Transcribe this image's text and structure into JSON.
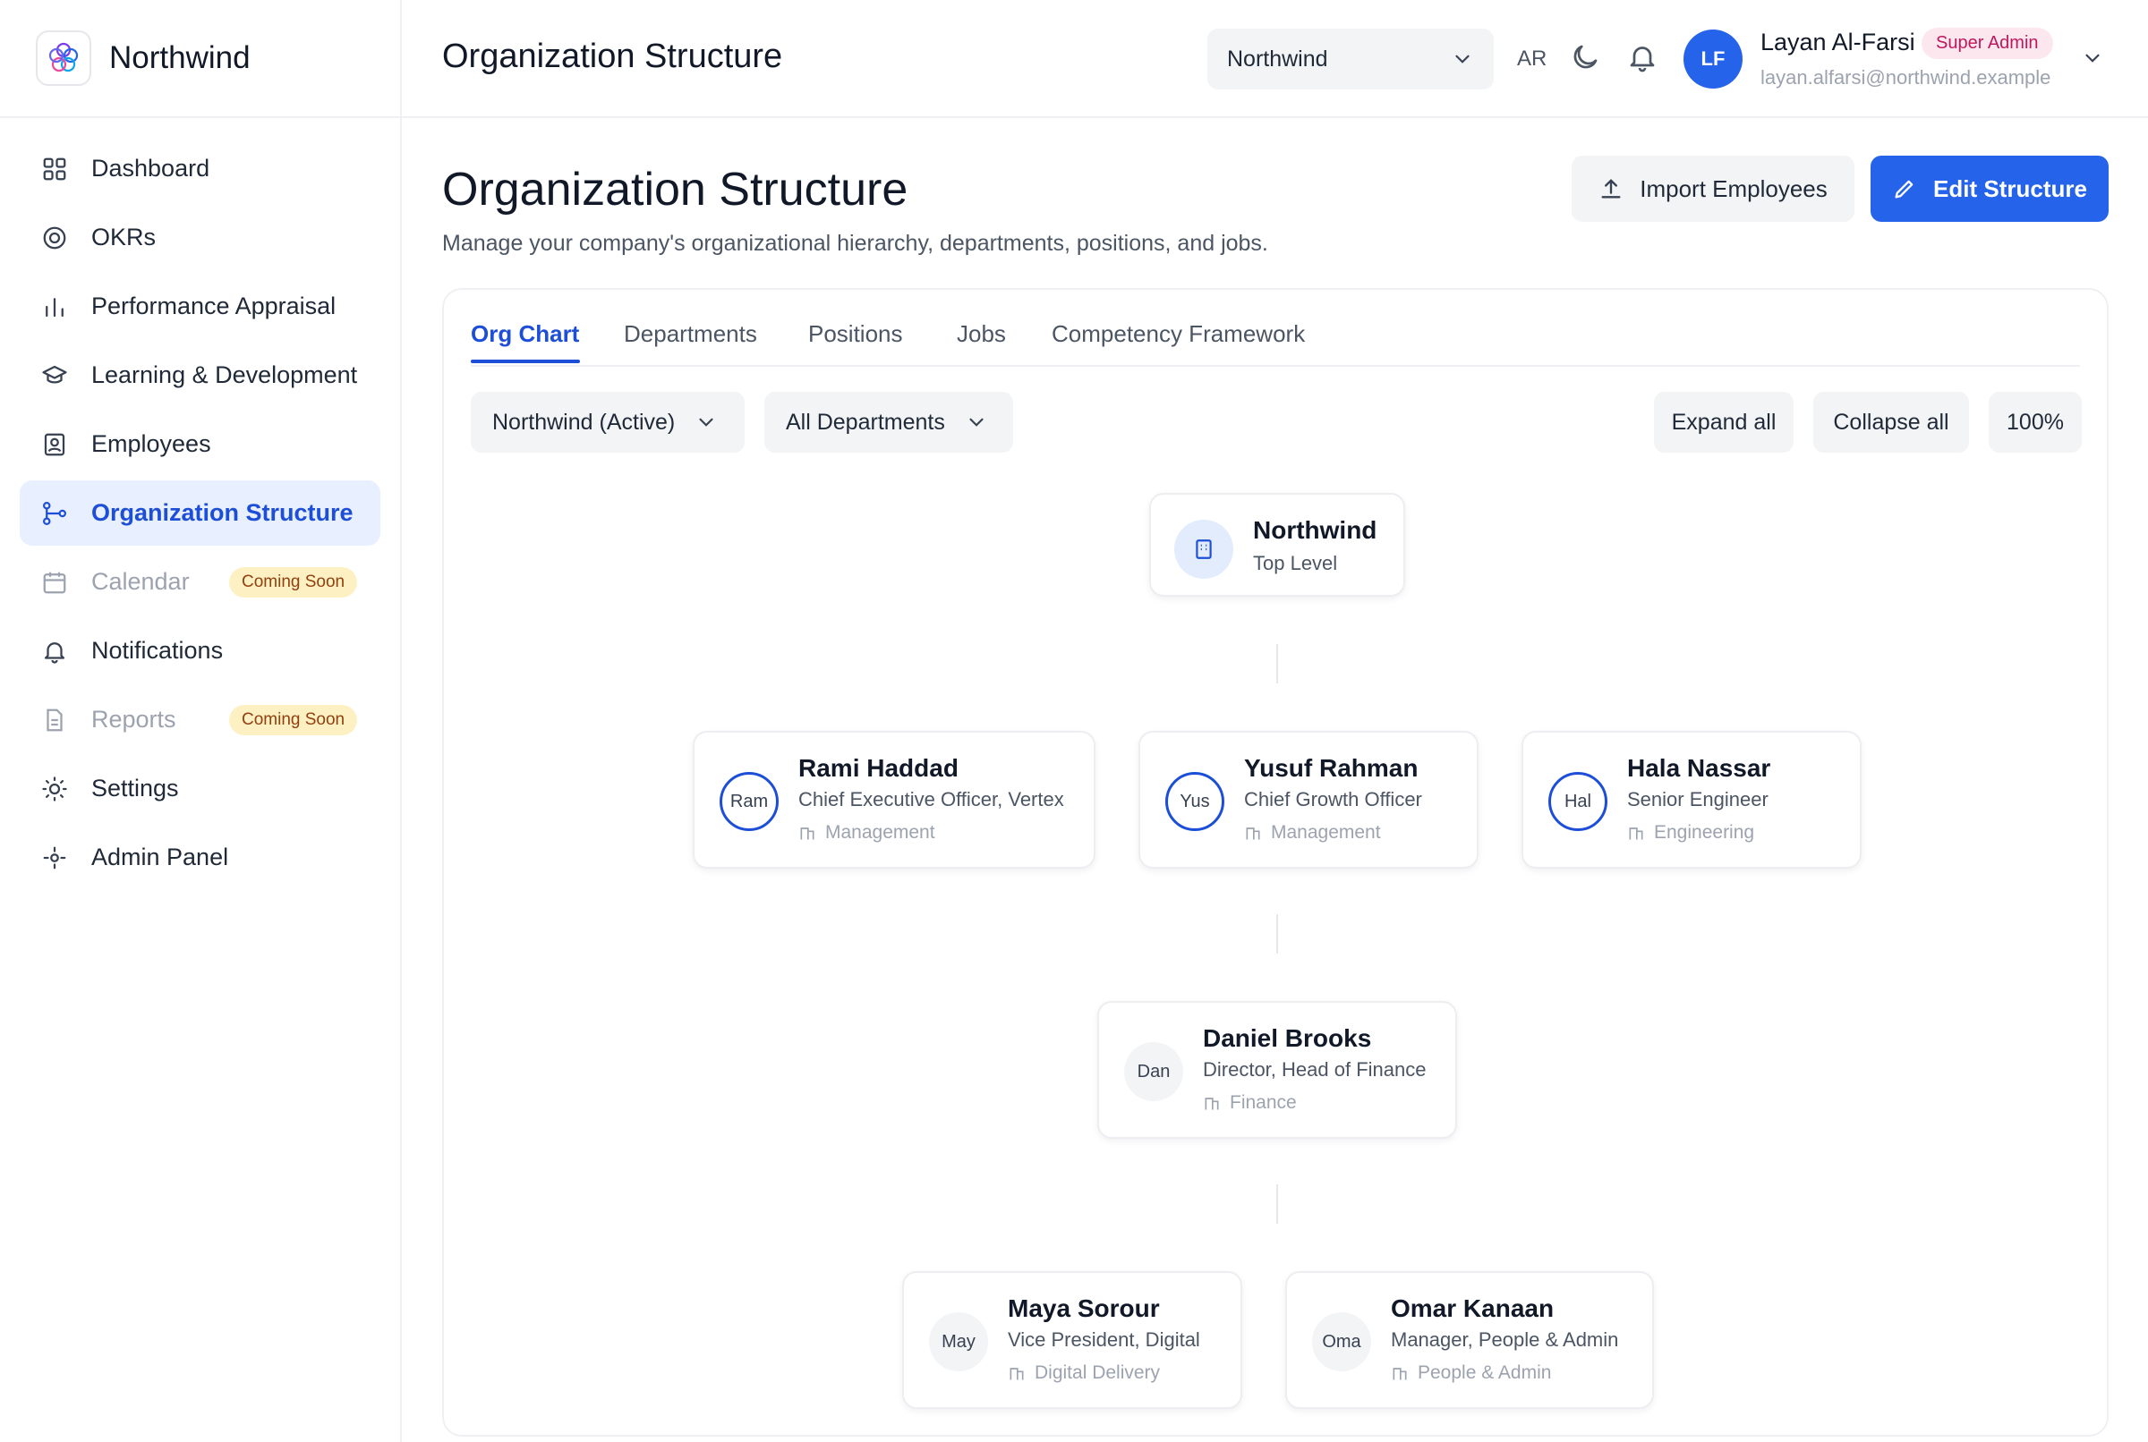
{
  "brand": {
    "name": "Northwind",
    "logo": "flower-logo-icon"
  },
  "sidebar": {
    "items": [
      {
        "label": "Dashboard",
        "icon": "grid-icon"
      },
      {
        "label": "OKRs",
        "icon": "target-icon"
      },
      {
        "label": "Performance Appraisal",
        "icon": "bar-chart-icon"
      },
      {
        "label": "Learning & Development",
        "icon": "graduation-cap-icon"
      },
      {
        "label": "Employees",
        "icon": "id-badge-icon"
      },
      {
        "label": "Organization Structure",
        "icon": "hierarchy-icon",
        "active": true
      },
      {
        "label": "Calendar",
        "icon": "calendar-icon",
        "badge": "Coming Soon",
        "disabled": true
      },
      {
        "label": "Notifications",
        "icon": "bell-icon"
      },
      {
        "label": "Reports",
        "icon": "document-icon",
        "badge": "Coming Soon",
        "disabled": true
      },
      {
        "label": "Settings",
        "icon": "sun-gear-icon"
      },
      {
        "label": "Admin Panel",
        "icon": "admin-cog-icon"
      }
    ]
  },
  "header": {
    "title": "Organization Structure",
    "org_select": "Northwind",
    "language": "AR",
    "user": {
      "initials": "LF",
      "name": "Layan Al-Farsi",
      "role": "Super Admin",
      "email": "layan.alfarsi@northwind.example"
    }
  },
  "page": {
    "title": "Organization Structure",
    "subtitle": "Manage your company's organizational hierarchy, departments, positions, and jobs.",
    "import_label": "Import Employees",
    "edit_label": "Edit Structure"
  },
  "tabs": [
    "Org Chart",
    "Departments",
    "Positions",
    "Jobs",
    "Competency Framework"
  ],
  "filters": {
    "company": "Northwind (Active)",
    "department": "All Departments",
    "expand": "Expand all",
    "collapse": "Collapse all",
    "zoom": "100%"
  },
  "org_chart": {
    "root": {
      "name": "Northwind",
      "level": "Top Level"
    },
    "level1": [
      {
        "initials": "Ram",
        "name": "Rami Haddad",
        "position": "Chief Executive Officer, Vertex",
        "department": "Management"
      },
      {
        "initials": "Yus",
        "name": "Yusuf Rahman",
        "position": "Chief Growth Officer",
        "department": "Management"
      },
      {
        "initials": "Hal",
        "name": "Hala Nassar",
        "position": "Senior Engineer",
        "department": "Engineering"
      }
    ],
    "level2": [
      {
        "initials": "Dan",
        "name": "Daniel Brooks",
        "position": "Director, Head of Finance",
        "department": "Finance"
      }
    ],
    "level3": [
      {
        "initials": "May",
        "name": "Maya Sorour",
        "position": "Vice President, Digital",
        "department": "Digital Delivery"
      },
      {
        "initials": "Oma",
        "name": "Omar Kanaan",
        "position": "Manager, People & Admin",
        "department": "People & Admin"
      }
    ]
  },
  "colors": {
    "accent": "#2563eb",
    "active_bg": "#e8effe",
    "badge_soon_bg": "#fdf1c4",
    "role_badge_bg": "#fde7ef"
  }
}
